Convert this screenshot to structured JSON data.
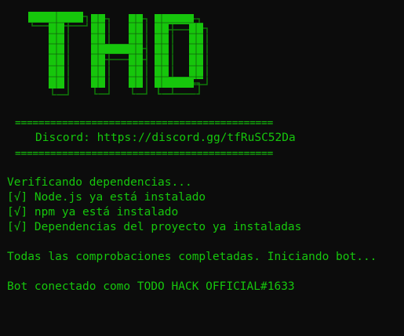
{
  "logo_text": "THD",
  "colors": {
    "background": "#0c0c0c",
    "green": "#16c60c",
    "dark_green": "#0e7a08"
  },
  "banner": {
    "rule_top": "============================================",
    "discord_line": "Discord: https://discord.gg/tfRuSC52Da",
    "rule_bottom": "============================================"
  },
  "output": {
    "verifying": "Verificando dependencias...",
    "checks": [
      "[√] Node.js ya está instalado",
      "[√] npm ya está instalado",
      "[√] Dependencias del proyecto ya instaladas"
    ],
    "all_done": "Todas las comprobaciones completadas. Iniciando bot...",
    "connected": "Bot conectado como TODO HACK OFFICIAL#1633"
  }
}
